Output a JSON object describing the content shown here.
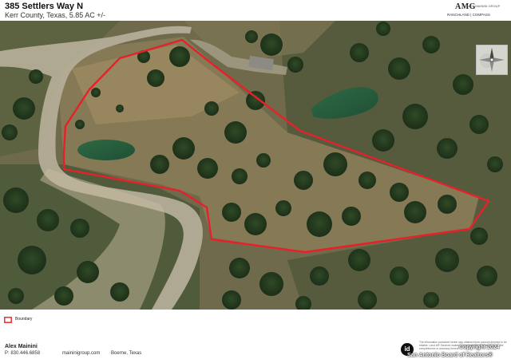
{
  "header": {
    "title": "385 Settlers Way N",
    "subtitle": "Kerr County, Texas, 5.85 AC +/-",
    "logo_mark": "AMG",
    "logo_sub": "ALEX MAININI GROUP",
    "logo_line2": "RANCHLAND | COMPASS"
  },
  "map": {
    "boundary_color": "#e8202a",
    "compass_icon": "north-arrow-icon"
  },
  "legend": {
    "items": [
      {
        "label": "Boundary",
        "color": "#e8202a",
        "icon": "boundary-swatch-icon"
      }
    ]
  },
  "footer": {
    "agent_name": "Alex Mainini",
    "phone": "P: 830.446.6858",
    "website": "maininigroup.com",
    "city": "Boerne, Texas",
    "id_badge": "id",
    "disclaimer": "The information contained herein was obtained from sources deemed to be reliable. Land id® Services makes no warranties or guarantees as to the completeness or accuracy thereof.",
    "copyright": "Copyright 2024",
    "source": "San Antonio Board of Realtors®"
  }
}
